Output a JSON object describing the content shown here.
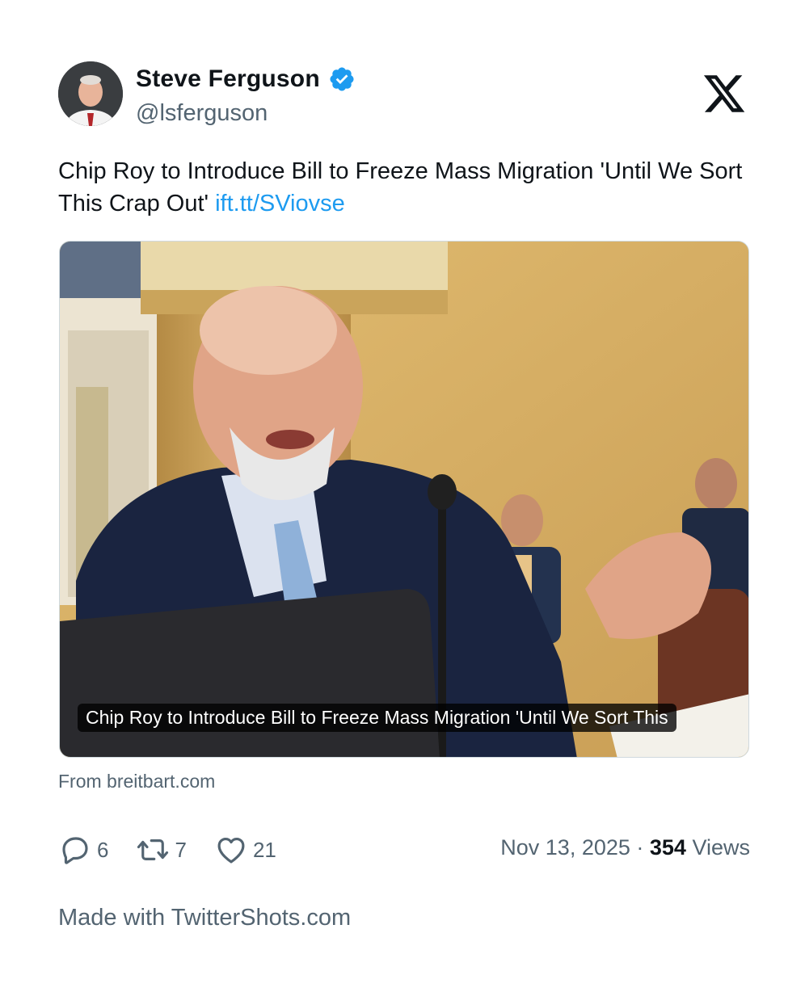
{
  "author": {
    "display_name": "Steve Ferguson",
    "handle": "@lsferguson",
    "verified": true,
    "verified_color": "#1d9bf0"
  },
  "brand_icon": "x-logo-icon",
  "tweet": {
    "text": "Chip Roy to Introduce Bill to Freeze Mass Migration 'Until We Sort This Crap Out' ",
    "link_text": "ift.tt/SViovse",
    "link_color": "#1d9bf0"
  },
  "media": {
    "caption": "Chip Roy to Introduce Bill to Freeze Mass Migration 'Until We Sort This",
    "source": "From breitbart.com"
  },
  "actions": {
    "replies": {
      "icon": "reply-icon",
      "count": "6"
    },
    "retweets": {
      "icon": "retweet-icon",
      "count": "7"
    },
    "likes": {
      "icon": "heart-icon",
      "count": "21"
    }
  },
  "meta": {
    "date": "Nov 13, 2025",
    "separator": " · ",
    "views_count": "354",
    "views_label": " Views"
  },
  "footer": {
    "text": "Made with TwitterShots.com"
  }
}
